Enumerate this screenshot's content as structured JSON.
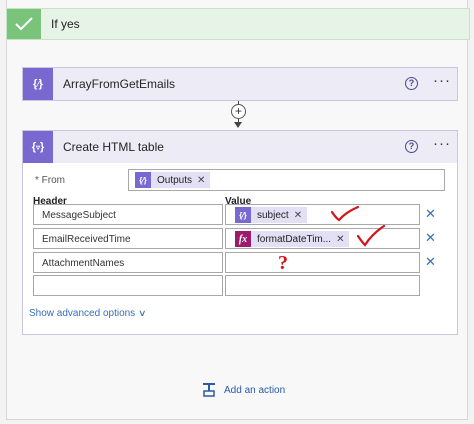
{
  "condition": {
    "label": "If yes"
  },
  "compose_card": {
    "title": "ArrayFromGetEmails"
  },
  "html_table_card": {
    "title": "Create HTML table",
    "from_label": "* From",
    "from_token": "Outputs",
    "header_col": "Header",
    "value_col": "Value",
    "rows": [
      {
        "header": "MessageSubject",
        "value_token": "subject",
        "value_type": "variable"
      },
      {
        "header": "EmailReceivedTime",
        "value_token": "formatDateTim...",
        "value_type": "expression"
      },
      {
        "header": "AttachmentNames",
        "value_token": "",
        "value_type": "none"
      },
      {
        "header": "",
        "value_token": "",
        "value_type": "none"
      }
    ],
    "show_advanced": "Show advanced options"
  },
  "annotations": {
    "question_mark": "?"
  },
  "add_action": {
    "label": "Add an action"
  },
  "icons": {
    "check": "check-icon",
    "compose": "compose-braces-icon",
    "table": "table-braces-icon",
    "help": "help-circle-icon",
    "more": "more-ellipsis-icon",
    "add": "add-step-icon",
    "expression": "fx-icon",
    "delete": "close-icon"
  },
  "colors": {
    "success_green": "#79c47a",
    "action_purple": "#7868d0",
    "expression_magenta": "#9d1b6c",
    "link_blue": "#3a6fb5",
    "annotation_red": "#d4131a"
  }
}
